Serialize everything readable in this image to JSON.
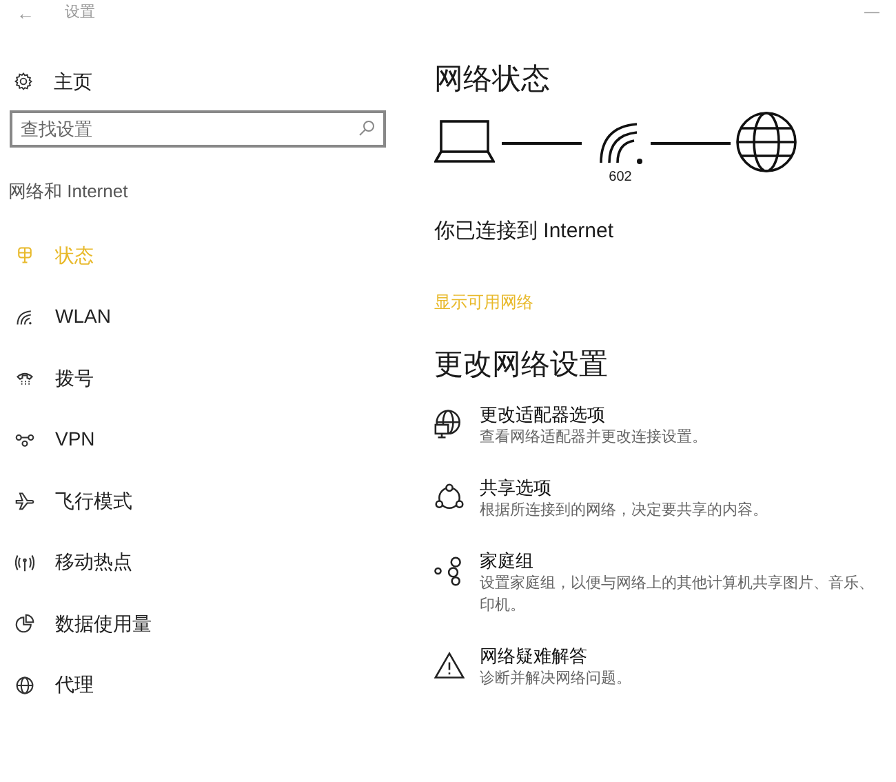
{
  "window": {
    "back": "←",
    "title": "设置",
    "minimize": "—"
  },
  "sidebar": {
    "home": "主页",
    "search": {
      "placeholder": "查找设置"
    },
    "section": "网络和 Internet",
    "items": [
      {
        "kind": "status",
        "label": "状态",
        "selected": true
      },
      {
        "kind": "wlan",
        "label": "WLAN",
        "selected": false
      },
      {
        "kind": "dialup",
        "label": "拨号",
        "selected": false
      },
      {
        "kind": "vpn",
        "label": "VPN",
        "selected": false
      },
      {
        "kind": "airplane",
        "label": "飞行模式",
        "selected": false
      },
      {
        "kind": "hotspot",
        "label": "移动热点",
        "selected": false
      },
      {
        "kind": "data",
        "label": "数据使用量",
        "selected": false
      },
      {
        "kind": "proxy",
        "label": "代理",
        "selected": false
      }
    ]
  },
  "main": {
    "title": "网络状态",
    "network_name": "602",
    "status": "你已连接到 Internet",
    "link": "显示可用网络",
    "section": "更改网络设置",
    "options": [
      {
        "kind": "adapter",
        "title": "更改适配器选项",
        "description": [
          "查看网络适配器并更改连接设置。"
        ]
      },
      {
        "kind": "sharing",
        "title": "共享选项",
        "description": [
          "根据所连接到的网络，决定要共享的内容。"
        ]
      },
      {
        "kind": "homegroup",
        "title": "家庭组",
        "description": [
          "设置家庭组，以便与网络上的其他计算机共享图片、音乐、",
          "印机。"
        ]
      },
      {
        "kind": "troubleshoot",
        "title": "网络疑难解答",
        "description": [
          "诊断并解决网络问题。"
        ]
      }
    ]
  }
}
